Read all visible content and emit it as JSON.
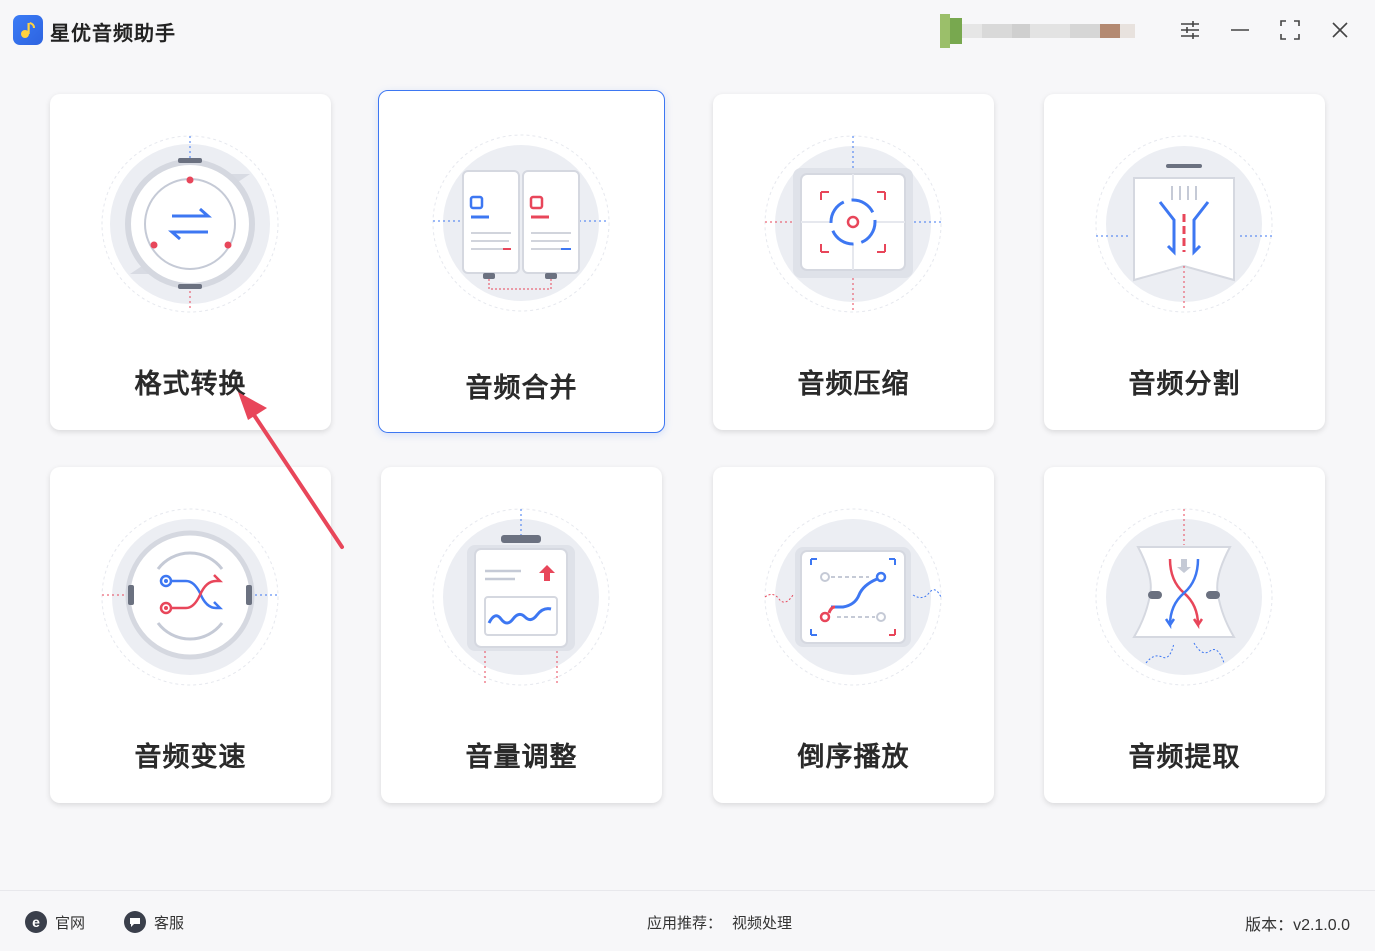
{
  "app": {
    "title": "星优音频助手",
    "accent": "#3d77f2",
    "red": "#e8465a"
  },
  "window_controls": [
    "settings-icon",
    "minimize-icon",
    "maximize-icon",
    "close-icon"
  ],
  "cards": [
    {
      "label": "格式转换",
      "icon": "format-convert-icon"
    },
    {
      "label": "音频合并",
      "icon": "audio-merge-icon"
    },
    {
      "label": "音频压缩",
      "icon": "audio-compress-icon"
    },
    {
      "label": "音频分割",
      "icon": "audio-split-icon"
    },
    {
      "label": "音频变速",
      "icon": "audio-speed-icon"
    },
    {
      "label": "音量调整",
      "icon": "volume-adjust-icon"
    },
    {
      "label": "倒序播放",
      "icon": "reverse-play-icon"
    },
    {
      "label": "音频提取",
      "icon": "audio-extract-icon"
    }
  ],
  "footer": {
    "website": "官网",
    "support": "客服",
    "recommend_label": "应用推荐：",
    "recommend_link": "视频处理",
    "version": "版本：v2.1.0.0"
  }
}
